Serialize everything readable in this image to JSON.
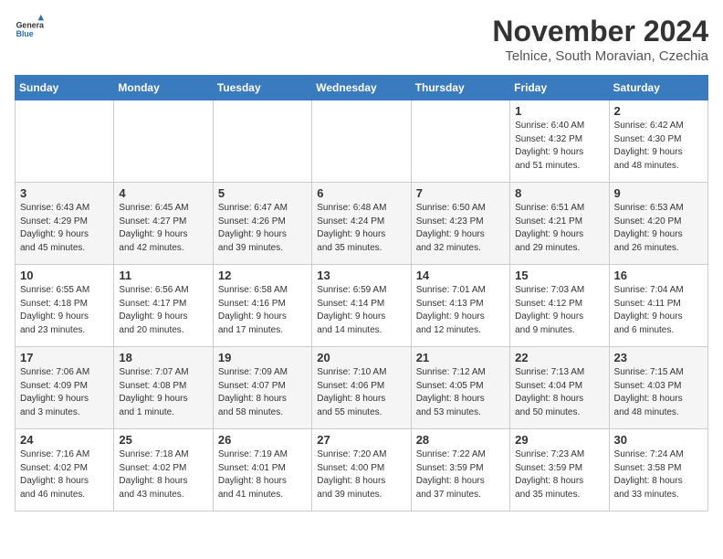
{
  "header": {
    "logo_line1": "General",
    "logo_line2": "Blue",
    "month_year": "November 2024",
    "location": "Telnice, South Moravian, Czechia"
  },
  "weekdays": [
    "Sunday",
    "Monday",
    "Tuesday",
    "Wednesday",
    "Thursday",
    "Friday",
    "Saturday"
  ],
  "weeks": [
    [
      {
        "day": "",
        "detail": ""
      },
      {
        "day": "",
        "detail": ""
      },
      {
        "day": "",
        "detail": ""
      },
      {
        "day": "",
        "detail": ""
      },
      {
        "day": "",
        "detail": ""
      },
      {
        "day": "1",
        "detail": "Sunrise: 6:40 AM\nSunset: 4:32 PM\nDaylight: 9 hours\nand 51 minutes."
      },
      {
        "day": "2",
        "detail": "Sunrise: 6:42 AM\nSunset: 4:30 PM\nDaylight: 9 hours\nand 48 minutes."
      }
    ],
    [
      {
        "day": "3",
        "detail": "Sunrise: 6:43 AM\nSunset: 4:29 PM\nDaylight: 9 hours\nand 45 minutes."
      },
      {
        "day": "4",
        "detail": "Sunrise: 6:45 AM\nSunset: 4:27 PM\nDaylight: 9 hours\nand 42 minutes."
      },
      {
        "day": "5",
        "detail": "Sunrise: 6:47 AM\nSunset: 4:26 PM\nDaylight: 9 hours\nand 39 minutes."
      },
      {
        "day": "6",
        "detail": "Sunrise: 6:48 AM\nSunset: 4:24 PM\nDaylight: 9 hours\nand 35 minutes."
      },
      {
        "day": "7",
        "detail": "Sunrise: 6:50 AM\nSunset: 4:23 PM\nDaylight: 9 hours\nand 32 minutes."
      },
      {
        "day": "8",
        "detail": "Sunrise: 6:51 AM\nSunset: 4:21 PM\nDaylight: 9 hours\nand 29 minutes."
      },
      {
        "day": "9",
        "detail": "Sunrise: 6:53 AM\nSunset: 4:20 PM\nDaylight: 9 hours\nand 26 minutes."
      }
    ],
    [
      {
        "day": "10",
        "detail": "Sunrise: 6:55 AM\nSunset: 4:18 PM\nDaylight: 9 hours\nand 23 minutes."
      },
      {
        "day": "11",
        "detail": "Sunrise: 6:56 AM\nSunset: 4:17 PM\nDaylight: 9 hours\nand 20 minutes."
      },
      {
        "day": "12",
        "detail": "Sunrise: 6:58 AM\nSunset: 4:16 PM\nDaylight: 9 hours\nand 17 minutes."
      },
      {
        "day": "13",
        "detail": "Sunrise: 6:59 AM\nSunset: 4:14 PM\nDaylight: 9 hours\nand 14 minutes."
      },
      {
        "day": "14",
        "detail": "Sunrise: 7:01 AM\nSunset: 4:13 PM\nDaylight: 9 hours\nand 12 minutes."
      },
      {
        "day": "15",
        "detail": "Sunrise: 7:03 AM\nSunset: 4:12 PM\nDaylight: 9 hours\nand 9 minutes."
      },
      {
        "day": "16",
        "detail": "Sunrise: 7:04 AM\nSunset: 4:11 PM\nDaylight: 9 hours\nand 6 minutes."
      }
    ],
    [
      {
        "day": "17",
        "detail": "Sunrise: 7:06 AM\nSunset: 4:09 PM\nDaylight: 9 hours\nand 3 minutes."
      },
      {
        "day": "18",
        "detail": "Sunrise: 7:07 AM\nSunset: 4:08 PM\nDaylight: 9 hours\nand 1 minute."
      },
      {
        "day": "19",
        "detail": "Sunrise: 7:09 AM\nSunset: 4:07 PM\nDaylight: 8 hours\nand 58 minutes."
      },
      {
        "day": "20",
        "detail": "Sunrise: 7:10 AM\nSunset: 4:06 PM\nDaylight: 8 hours\nand 55 minutes."
      },
      {
        "day": "21",
        "detail": "Sunrise: 7:12 AM\nSunset: 4:05 PM\nDaylight: 8 hours\nand 53 minutes."
      },
      {
        "day": "22",
        "detail": "Sunrise: 7:13 AM\nSunset: 4:04 PM\nDaylight: 8 hours\nand 50 minutes."
      },
      {
        "day": "23",
        "detail": "Sunrise: 7:15 AM\nSunset: 4:03 PM\nDaylight: 8 hours\nand 48 minutes."
      }
    ],
    [
      {
        "day": "24",
        "detail": "Sunrise: 7:16 AM\nSunset: 4:02 PM\nDaylight: 8 hours\nand 46 minutes."
      },
      {
        "day": "25",
        "detail": "Sunrise: 7:18 AM\nSunset: 4:02 PM\nDaylight: 8 hours\nand 43 minutes."
      },
      {
        "day": "26",
        "detail": "Sunrise: 7:19 AM\nSunset: 4:01 PM\nDaylight: 8 hours\nand 41 minutes."
      },
      {
        "day": "27",
        "detail": "Sunrise: 7:20 AM\nSunset: 4:00 PM\nDaylight: 8 hours\nand 39 minutes."
      },
      {
        "day": "28",
        "detail": "Sunrise: 7:22 AM\nSunset: 3:59 PM\nDaylight: 8 hours\nand 37 minutes."
      },
      {
        "day": "29",
        "detail": "Sunrise: 7:23 AM\nSunset: 3:59 PM\nDaylight: 8 hours\nand 35 minutes."
      },
      {
        "day": "30",
        "detail": "Sunrise: 7:24 AM\nSunset: 3:58 PM\nDaylight: 8 hours\nand 33 minutes."
      }
    ]
  ]
}
